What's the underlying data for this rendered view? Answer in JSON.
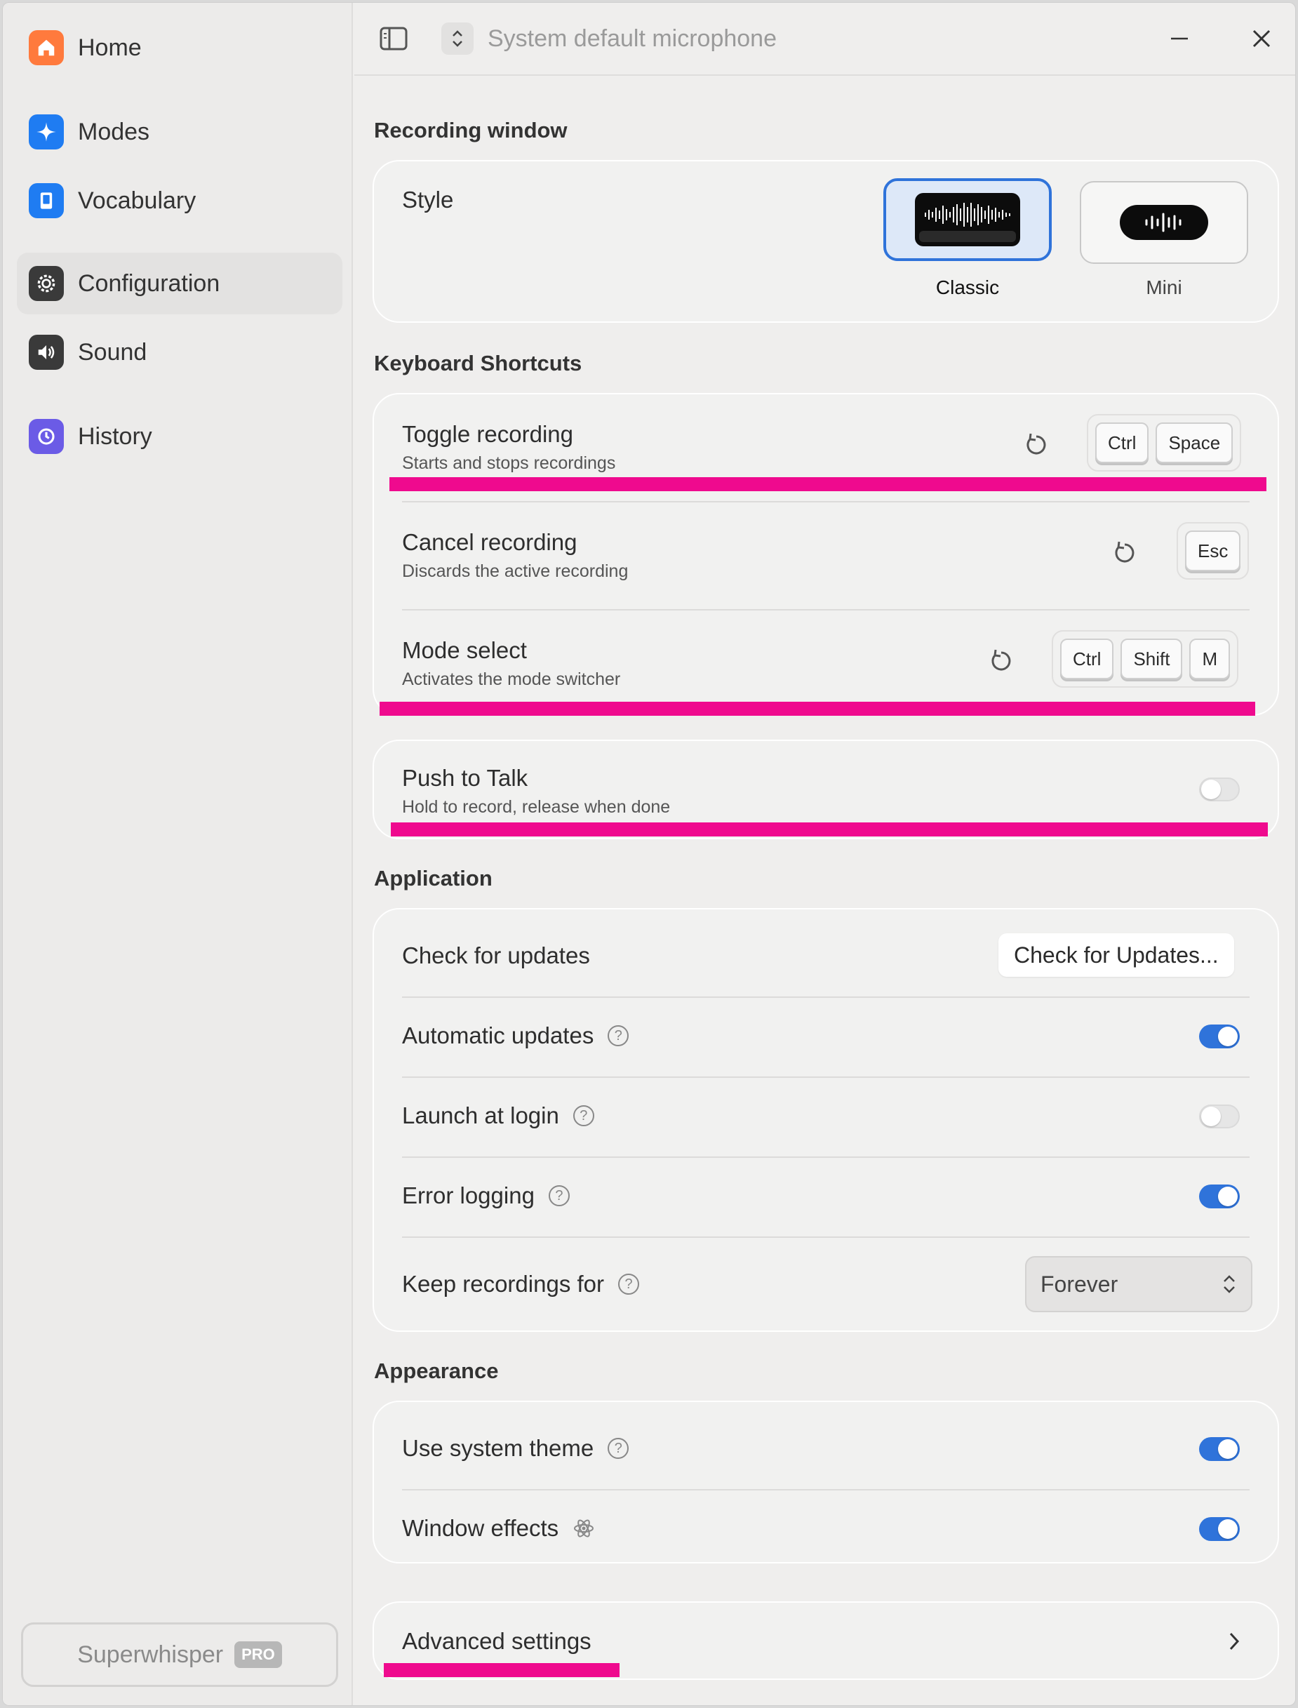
{
  "titlebar": {
    "microphone_label": "System default microphone"
  },
  "sidebar": {
    "items": [
      {
        "label": "Home",
        "icon": "house-icon",
        "color": "#ff7a3d"
      },
      {
        "label": "Modes",
        "icon": "sparkle-icon",
        "color": "#1f7cf2"
      },
      {
        "label": "Vocabulary",
        "icon": "book-icon",
        "color": "#1f7cf2"
      },
      {
        "label": "Configuration",
        "icon": "gear-icon",
        "color": "#3a3a3a",
        "active": true
      },
      {
        "label": "Sound",
        "icon": "speaker-icon",
        "color": "#3a3a3a"
      },
      {
        "label": "History",
        "icon": "history-icon",
        "color": "#6b5be6"
      }
    ],
    "footer": {
      "label": "Superwhisper",
      "badge": "PRO"
    }
  },
  "sections": {
    "recording_window": {
      "title": "Recording window",
      "style_label": "Style",
      "options": [
        {
          "label": "Classic",
          "selected": true
        },
        {
          "label": "Mini",
          "selected": false
        }
      ]
    },
    "keyboard_shortcuts": {
      "title": "Keyboard Shortcuts",
      "rows": [
        {
          "title": "Toggle recording",
          "subtitle": "Starts and stops recordings",
          "keys": [
            "Ctrl",
            "Space"
          ]
        },
        {
          "title": "Cancel recording",
          "subtitle": "Discards the active recording",
          "keys": [
            "Esc"
          ]
        },
        {
          "title": "Mode select",
          "subtitle": "Activates the mode switcher",
          "keys": [
            "Ctrl",
            "Shift",
            "M"
          ]
        }
      ],
      "push_to_talk": {
        "title": "Push to Talk",
        "subtitle": "Hold to record, release when done",
        "on": false
      }
    },
    "application": {
      "title": "Application",
      "check_updates": {
        "label": "Check for updates",
        "button": "Check for Updates..."
      },
      "automatic_updates": {
        "label": "Automatic updates",
        "on": true
      },
      "launch_at_login": {
        "label": "Launch at login",
        "on": false
      },
      "error_logging": {
        "label": "Error logging",
        "on": true
      },
      "keep_recordings": {
        "label": "Keep recordings for",
        "value": "Forever"
      }
    },
    "appearance": {
      "title": "Appearance",
      "system_theme": {
        "label": "Use system theme",
        "on": true
      },
      "window_effects": {
        "label": "Window effects",
        "on": true
      }
    },
    "advanced": {
      "label": "Advanced settings"
    }
  },
  "colors": {
    "accent": "#2f73da",
    "highlight": "#ef0a8e"
  }
}
